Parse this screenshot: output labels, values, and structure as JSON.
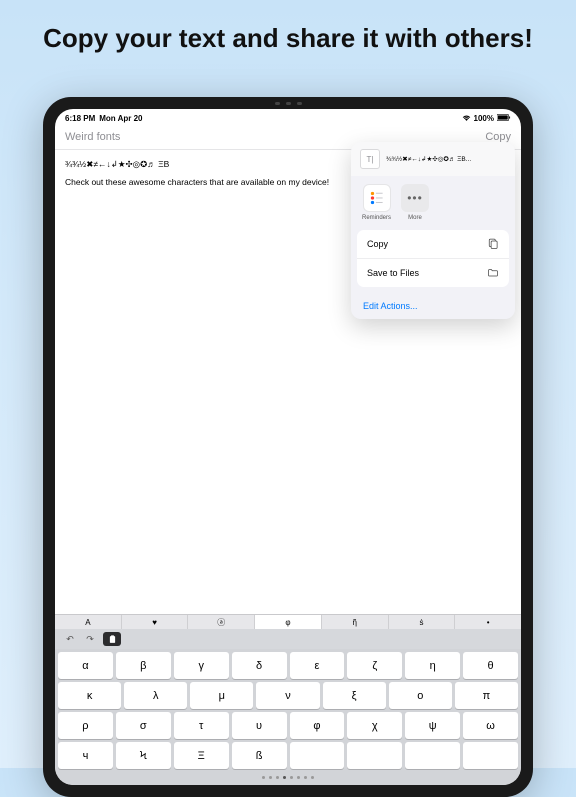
{
  "headline": "Copy your text and share it with others!",
  "status": {
    "time": "6:18 PM",
    "date": "Mon Apr 20",
    "battery": "100%"
  },
  "nav": {
    "title": "Weird fonts",
    "action": "Copy"
  },
  "document": {
    "line1": "¾¾½✖≠←↓↲★✣◎✪♬ ΞB",
    "line2": "Check out these awesome characters that are available on my device!"
  },
  "share": {
    "preview": "¾¾½✖≠←↓↲★✣◎✪♬ ΞB...",
    "apps": {
      "reminders": "Reminders",
      "more": "More"
    },
    "actions": {
      "copy": "Copy",
      "saveFiles": "Save to Files"
    },
    "editActions": "Edit Actions..."
  },
  "suggestions": [
    "A",
    "♥",
    "ⓐ",
    "φ",
    "ῆ",
    "ṡ",
    "•"
  ],
  "keyboard": {
    "row1": [
      "α",
      "β",
      "γ",
      "δ",
      "ε",
      "ζ",
      "η",
      "θ"
    ],
    "row2": [
      "κ",
      "λ",
      "μ",
      "ν",
      "ξ",
      "ο",
      "π"
    ],
    "row3": [
      "ρ",
      "σ",
      "τ",
      "υ",
      "φ",
      "χ",
      "ψ",
      "ω"
    ],
    "row4": [
      "ч",
      "Ϟ",
      "Ξ",
      "ß",
      "",
      "",
      "",
      ""
    ]
  }
}
